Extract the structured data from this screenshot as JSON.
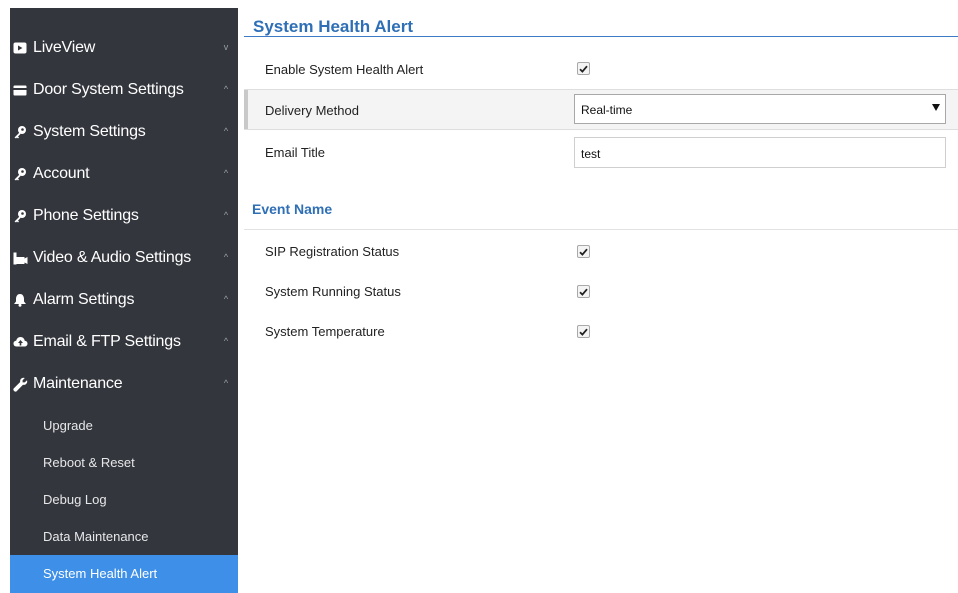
{
  "sidebar": {
    "menu": [
      {
        "label": "LiveView",
        "icon": "monitor-icon",
        "chevron": "v"
      },
      {
        "label": "Door System Settings",
        "icon": "card-icon",
        "chevron": "^"
      },
      {
        "label": "System Settings",
        "icon": "key-icon",
        "chevron": "^"
      },
      {
        "label": "Account",
        "icon": "key-icon",
        "chevron": "^"
      },
      {
        "label": "Phone Settings",
        "icon": "key-icon",
        "chevron": "^"
      },
      {
        "label": "Video & Audio Settings",
        "icon": "camera-icon",
        "chevron": "^"
      },
      {
        "label": "Alarm Settings",
        "icon": "bell-icon",
        "chevron": "^"
      },
      {
        "label": "Email & FTP Settings",
        "icon": "cloud-icon",
        "chevron": "^"
      },
      {
        "label": "Maintenance",
        "icon": "wrench-icon",
        "chevron": "^"
      }
    ],
    "maintenance_sub": [
      {
        "label": "Upgrade"
      },
      {
        "label": "Reboot & Reset"
      },
      {
        "label": "Debug Log"
      },
      {
        "label": "Data Maintenance"
      },
      {
        "label": "System Health Alert",
        "active": true
      }
    ],
    "active_color": "#3d8fe8",
    "background_color": "#33363d"
  },
  "main": {
    "title": "System Health Alert",
    "enable_label": "Enable System Health Alert",
    "enable_checked": true,
    "delivery_label": "Delivery Method",
    "delivery_value": "Real-time",
    "email_title_label": "Email Title",
    "email_title_value": "test",
    "section_title": "Event Name",
    "events": [
      {
        "label": "SIP Registration Status",
        "checked": true
      },
      {
        "label": "System Running Status",
        "checked": true
      },
      {
        "label": "System Temperature",
        "checked": true
      }
    ],
    "accent_color": "#2f6fb6"
  }
}
